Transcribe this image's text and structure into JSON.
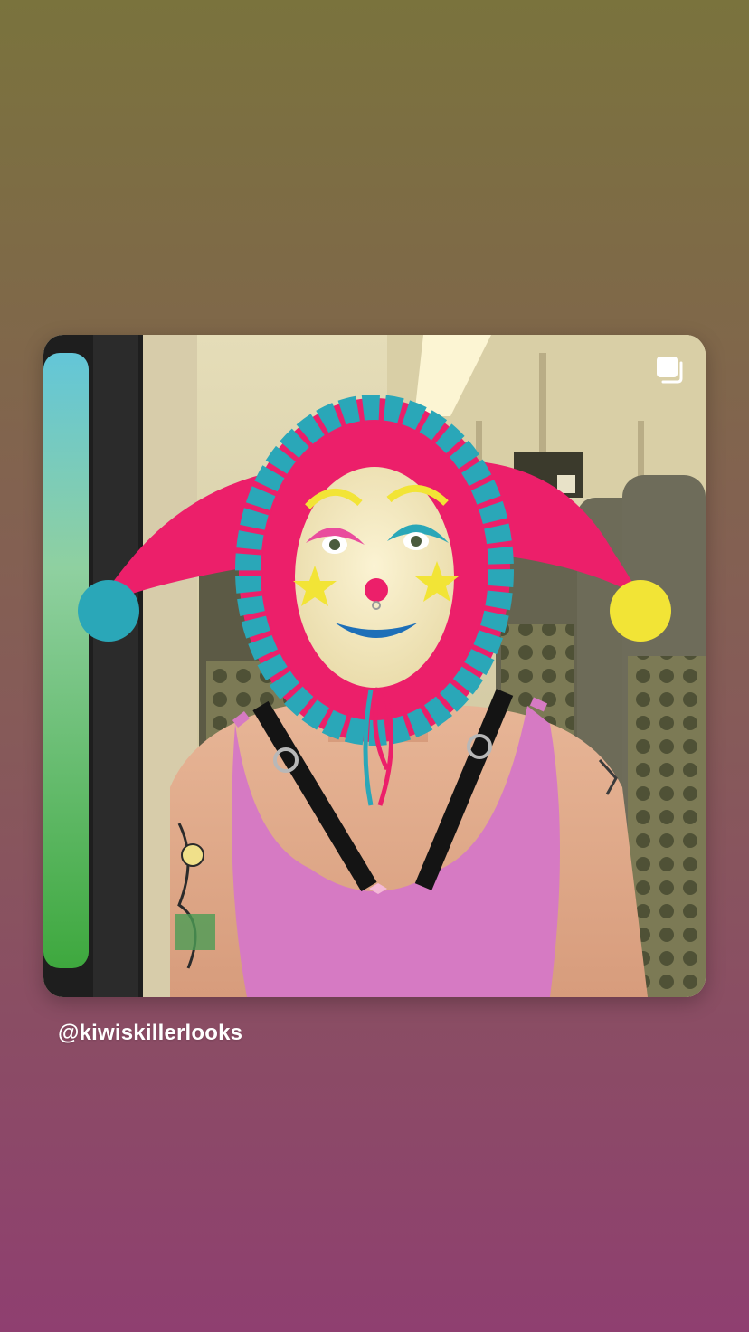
{
  "story": {
    "background_top": "#7a733d",
    "background_mid": "#865a59",
    "background_bottom": "#8f3f70"
  },
  "post": {
    "photo_description": "",
    "multi_image_icon": "multiple-posts-icon",
    "username": "@kiwiskillerlooks"
  },
  "colors": {
    "hat_pink": "#ec1f6a",
    "hat_teal": "#2aa7b8",
    "pompom_yellow": "#f2e436",
    "top_pink": "#d67ac3",
    "window_green": "#4fb24c"
  }
}
